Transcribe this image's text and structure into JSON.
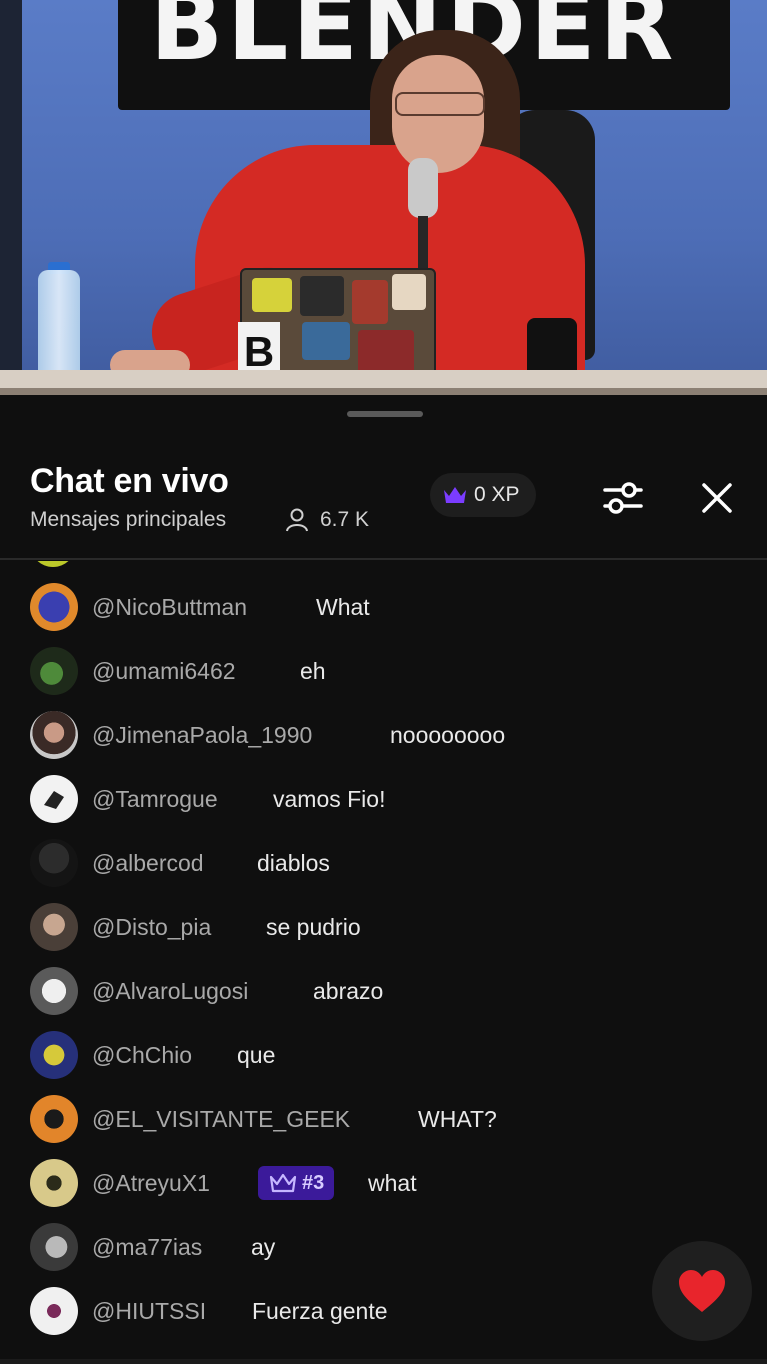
{
  "video": {
    "banner_text": "BLENDER",
    "laptop_letter": "B"
  },
  "chat": {
    "title": "Chat en vivo",
    "subtitle": "Mensajes principales",
    "viewers": "6.7 K",
    "xp_label": "0 XP",
    "icons": {
      "viewer": "person-icon",
      "crown": "crown-icon",
      "filter": "sliders-icon",
      "close": "close-icon",
      "heart": "heart-icon"
    },
    "colors": {
      "accent_purple": "#7b3cff",
      "badge_bg": "#3b1a9a",
      "heart_red": "#e8252c"
    },
    "messages": [
      {
        "author": "@NicoButtman",
        "text": "What"
      },
      {
        "author": "@umami6462",
        "text": "eh"
      },
      {
        "author": "@JimenaPaola_1990",
        "text": "noooooooo"
      },
      {
        "author": "@Tamrogue",
        "text": "vamos Fio!"
      },
      {
        "author": "@albercod",
        "text": "diablos"
      },
      {
        "author": "@Disto_pia",
        "text": "se pudrio"
      },
      {
        "author": "@AlvaroLugosi",
        "text": "abrazo"
      },
      {
        "author": "@ChChio",
        "text": "que"
      },
      {
        "author": "@EL_VISITANTE_GEEK",
        "text": "WHAT?"
      },
      {
        "author": "@AtreyuX1",
        "badge": "#3",
        "text": "what"
      },
      {
        "author": "@ma77ias",
        "text": "ay"
      },
      {
        "author": "@HIUTSSI",
        "text": "Fuerza gente"
      }
    ]
  }
}
